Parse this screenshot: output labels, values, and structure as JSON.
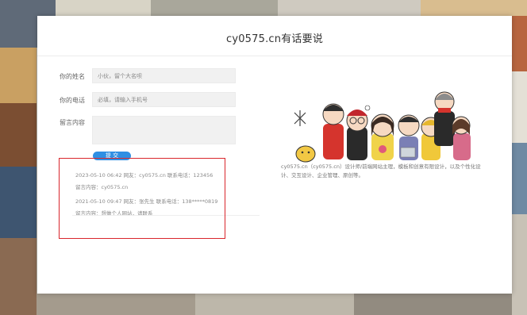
{
  "page_title": "cy0575.cn有话要说",
  "form": {
    "name_label": "你的姓名",
    "name_placeholder": "小伙，留个大名呗",
    "phone_label": "你的电话",
    "phone_placeholder": "必填，请输入手机号",
    "message_label": "留言内容",
    "submit_label": "提 交"
  },
  "messages": [
    {
      "line": "2023-05-10 06:42 网友：cy0575.cn 联系电话：123456"
    },
    {
      "line": "留言内容：cy0575.cn"
    },
    {
      "line": "2021-05-10 09:47 网友：张先生 联系电话：138*****0819"
    },
    {
      "line": "留言内容：想做个人网站，请联系"
    }
  ],
  "description": "cy0575.cn（cy0575.cn）设计师/前端网站主理，模板和创意有限设计，以及个性化设计、交互设计、企业管理、原创等。",
  "colors": {
    "accent": "#2f8fe3",
    "highlight_border": "#d9262c"
  }
}
